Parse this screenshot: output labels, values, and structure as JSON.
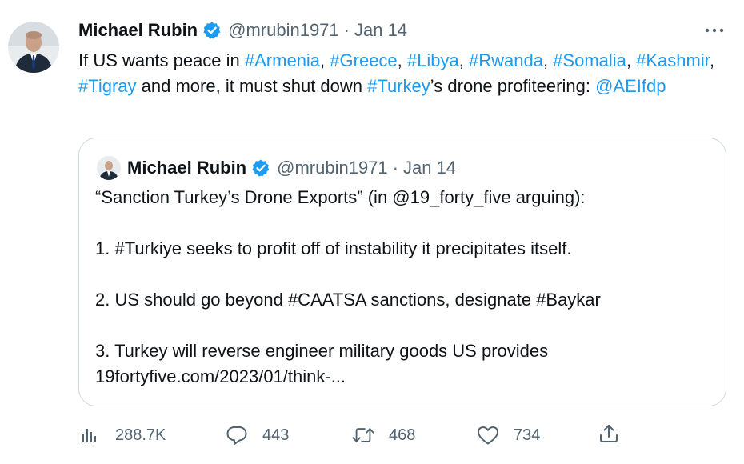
{
  "tweet": {
    "author_name": "Michael Rubin",
    "handle": "@mrubin1971",
    "separator": "·",
    "date": "Jan 14",
    "text": [
      {
        "t": "If US wants peace in ",
        "link": false
      },
      {
        "t": "#Armenia",
        "link": true
      },
      {
        "t": ", ",
        "link": false
      },
      {
        "t": "#Greece",
        "link": true
      },
      {
        "t": ", ",
        "link": false
      },
      {
        "t": "#Libya",
        "link": true
      },
      {
        "t": ", ",
        "link": false
      },
      {
        "t": "#Rwanda",
        "link": true
      },
      {
        "t": ", ",
        "link": false
      },
      {
        "t": "#Somalia",
        "link": true
      },
      {
        "t": ", ",
        "link": false
      },
      {
        "t": "#Kashmir",
        "link": true
      },
      {
        "t": ", ",
        "link": false
      },
      {
        "t": "#Tigray",
        "link": true
      },
      {
        "t": " and more, it must shut down ",
        "link": false
      },
      {
        "t": "#Turkey",
        "link": true
      },
      {
        "t": "’s drone profiteering: ",
        "link": false
      },
      {
        "t": "@AEIfdp",
        "link": true
      }
    ]
  },
  "quote": {
    "author_name": "Michael Rubin",
    "handle": "@mrubin1971",
    "separator": "·",
    "date": "Jan 14",
    "line1": "“Sanction Turkey’s Drone Exports” (in @19_forty_five arguing):",
    "line2": "1. #Turkiye seeks to profit off of instability it precipitates itself.",
    "line3": "2. US should go beyond #CAATSA sanctions, designate #Baykar",
    "line4": "3. Turkey will reverse engineer military goods US provides",
    "line5": "19fortyfive.com/2023/01/think-..."
  },
  "actions": {
    "views": "288.7K",
    "replies": "443",
    "retweets": "468",
    "likes": "734"
  },
  "colors": {
    "link": "#1d9bf0",
    "secondary_text": "#536471",
    "verified": "#1d9bf0"
  },
  "icons": [
    "views-icon",
    "reply-icon",
    "retweet-icon",
    "like-icon",
    "share-icon",
    "more-icon",
    "verified-badge-icon"
  ]
}
